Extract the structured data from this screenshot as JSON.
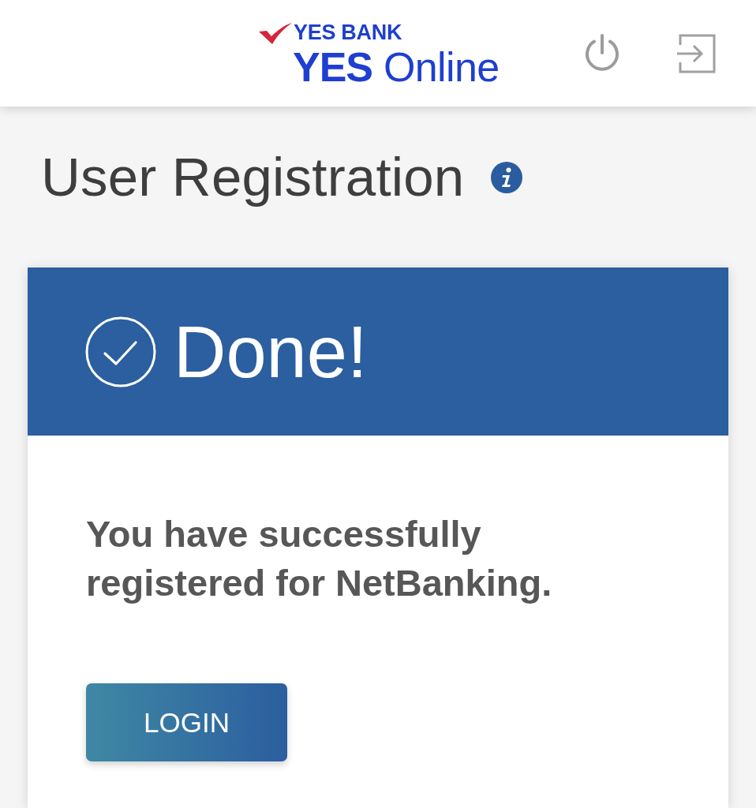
{
  "header": {
    "brand": "YES BANK",
    "product": "**YES** Online",
    "actions": [
      {
        "kind": "power"
      },
      {
        "kind": "exit"
      }
    ]
  },
  "page": {
    "title": "User Registration",
    "info": true
  },
  "status_card": {
    "kind": "success",
    "heading": "Done!",
    "message": "You have successfully registered for NetBanking.",
    "button": "LOGIN"
  }
}
